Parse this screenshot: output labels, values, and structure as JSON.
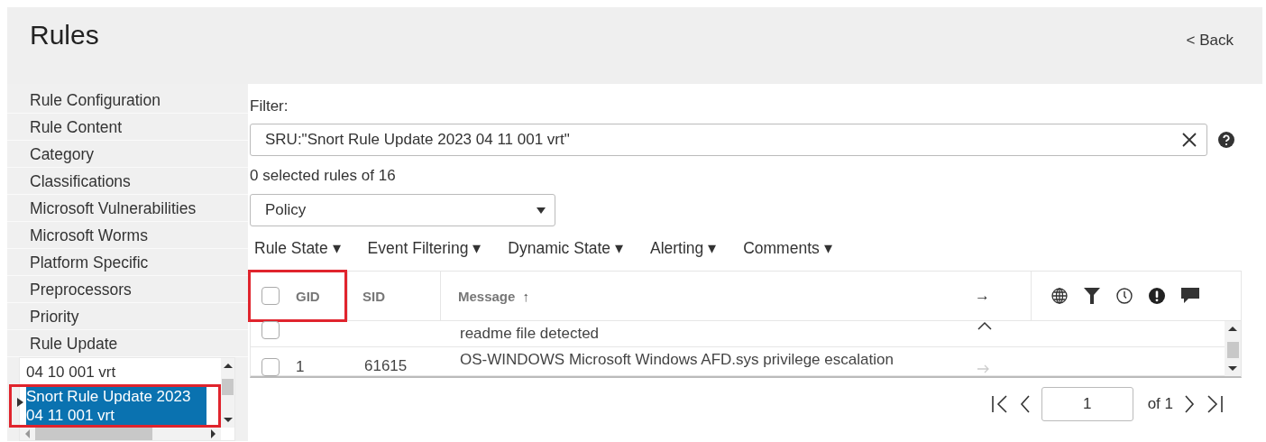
{
  "header": {
    "title": "Rules",
    "back_link": "< Back"
  },
  "sidebar": {
    "items": [
      {
        "label": "Rule Configuration"
      },
      {
        "label": "Rule Content"
      },
      {
        "label": "Category"
      },
      {
        "label": "Classifications"
      },
      {
        "label": "Microsoft Vulnerabilities"
      },
      {
        "label": "Microsoft Worms"
      },
      {
        "label": "Platform Specific"
      },
      {
        "label": "Preprocessors"
      },
      {
        "label": "Priority"
      },
      {
        "label": "Rule Update"
      }
    ],
    "tree": {
      "items": [
        {
          "label": "04 10 001 vrt",
          "selected": false,
          "highlighted": false
        },
        {
          "label": "Snort Rule Update 2023 04 11 001 vrt",
          "selected": true,
          "expanded": false,
          "highlighted": true
        }
      ]
    }
  },
  "filter": {
    "label": "Filter:",
    "value": "SRU:\"Snort Rule Update 2023 04 11 001 vrt\""
  },
  "selection_count": "0 selected rules of 16",
  "policy_select": {
    "value": "Policy"
  },
  "toolbar_menus": [
    {
      "label": "Rule State ▾"
    },
    {
      "label": "Event Filtering ▾"
    },
    {
      "label": "Dynamic State ▾"
    },
    {
      "label": "Alerting ▾"
    },
    {
      "label": "Comments ▾"
    }
  ],
  "table": {
    "columns": [
      {
        "label": "GID",
        "highlighted": true
      },
      {
        "label": "SID"
      },
      {
        "label": "Message",
        "sort": "↑"
      },
      {
        "label": "→"
      }
    ],
    "rows": [
      {
        "checked": false,
        "message": "readme file detected",
        "kind": "collapse"
      },
      {
        "checked": false,
        "gid": "1",
        "sid": "61615",
        "message": "OS-WINDOWS Microsoft Windows AFD.sys privilege escalation",
        "kind": "arrow"
      }
    ]
  },
  "pagination": {
    "page": "1",
    "of_label": "of 1"
  }
}
